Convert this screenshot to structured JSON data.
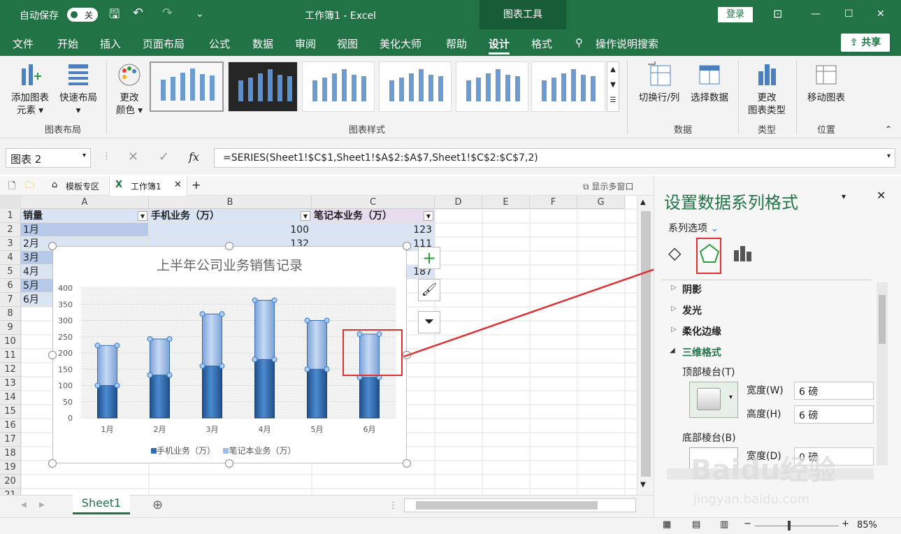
{
  "titlebar": {
    "autosave": "自动保存",
    "autosave_state": "关",
    "doc_title": "工作簿1 - Excel",
    "chart_tools": "图表工具",
    "login": "登录"
  },
  "menu": {
    "items": [
      "文件",
      "开始",
      "插入",
      "页面布局",
      "公式",
      "数据",
      "审阅",
      "视图",
      "美化大师",
      "帮助",
      "设计",
      "格式"
    ],
    "active": "设计",
    "search": "操作说明搜索",
    "share": "共享"
  },
  "ribbon": {
    "add_element": "添加图表",
    "add_element2": "元素",
    "quick_layout": "快速布局",
    "change_color": "更改",
    "change_color2": "颜色",
    "group_layout": "图表布局",
    "group_styles": "图表样式",
    "switch_rowcol": "切换行/列",
    "select_data": "选择数据",
    "group_data": "数据",
    "change_type": "更改",
    "change_type2": "图表类型",
    "group_type": "类型",
    "move_chart": "移动图表",
    "group_location": "位置"
  },
  "formula": {
    "namebox": "图表 2",
    "fx": "fx",
    "content": "=SERIES(Sheet1!$C$1,Sheet1!$A$2:$A$7,Sheet1!$C$2:$C$7,2)"
  },
  "tabs": {
    "template": "模板专区",
    "workbook": "工作簿1",
    "show_multi": "显示多窗口"
  },
  "grid": {
    "columns": [
      "A",
      "B",
      "C",
      "D",
      "E",
      "F",
      "G"
    ],
    "rows": [
      "1",
      "2",
      "3",
      "4",
      "5",
      "6",
      "7",
      "8",
      "9",
      "10",
      "11",
      "12",
      "13",
      "14",
      "15",
      "16",
      "17",
      "18",
      "19",
      "20",
      "21"
    ],
    "header": [
      "销量",
      "手机业务（万）",
      "笔记本业务（万）"
    ],
    "a_col": [
      "1月",
      "2月",
      "3月",
      "4月",
      "5月",
      "6月"
    ],
    "b_col": [
      "100",
      "132"
    ],
    "c_col": [
      "123",
      "111",
      "",
      "187",
      "",
      ""
    ]
  },
  "chart_data": {
    "type": "bar",
    "stacked": true,
    "title": "上半年公司业务销售记录",
    "categories": [
      "1月",
      "2月",
      "3月",
      "4月",
      "5月",
      "6月"
    ],
    "series": [
      {
        "name": "手机业务（万）",
        "values": [
          100,
          132,
          160,
          180,
          150,
          125
        ],
        "color": "#2e6db0"
      },
      {
        "name": "笔记本业务（万）",
        "values": [
          123,
          111,
          160,
          182,
          150,
          133
        ],
        "color": "#9dbde8"
      }
    ],
    "yticks": [
      "0",
      "50",
      "100",
      "150",
      "200",
      "250",
      "300",
      "350",
      "400"
    ],
    "ylim": [
      0,
      400
    ],
    "legend": "bottom"
  },
  "sheet_tab": "Sheet1",
  "panel": {
    "title": "设置数据系列格式",
    "series_options": "系列选项",
    "shadow": "阴影",
    "glow": "发光",
    "soft_edges": "柔化边缘",
    "format3d": "三维格式",
    "top_bevel": "顶部棱台(T)",
    "width_label": "宽度(W)",
    "width_val": "6 磅",
    "height_label": "高度(H)",
    "height_val": "6 磅",
    "bottom_bevel": "底部棱台(B)",
    "bwidth_label": "宽度(D)",
    "bwidth_val": "0 磅"
  },
  "status": {
    "zoom": "85%"
  },
  "watermark": {
    "line1": "Baidu经验",
    "line2": "jingyan.baidu.com"
  },
  "colors": {
    "excel_green": "#217346",
    "red": "#e03030"
  }
}
